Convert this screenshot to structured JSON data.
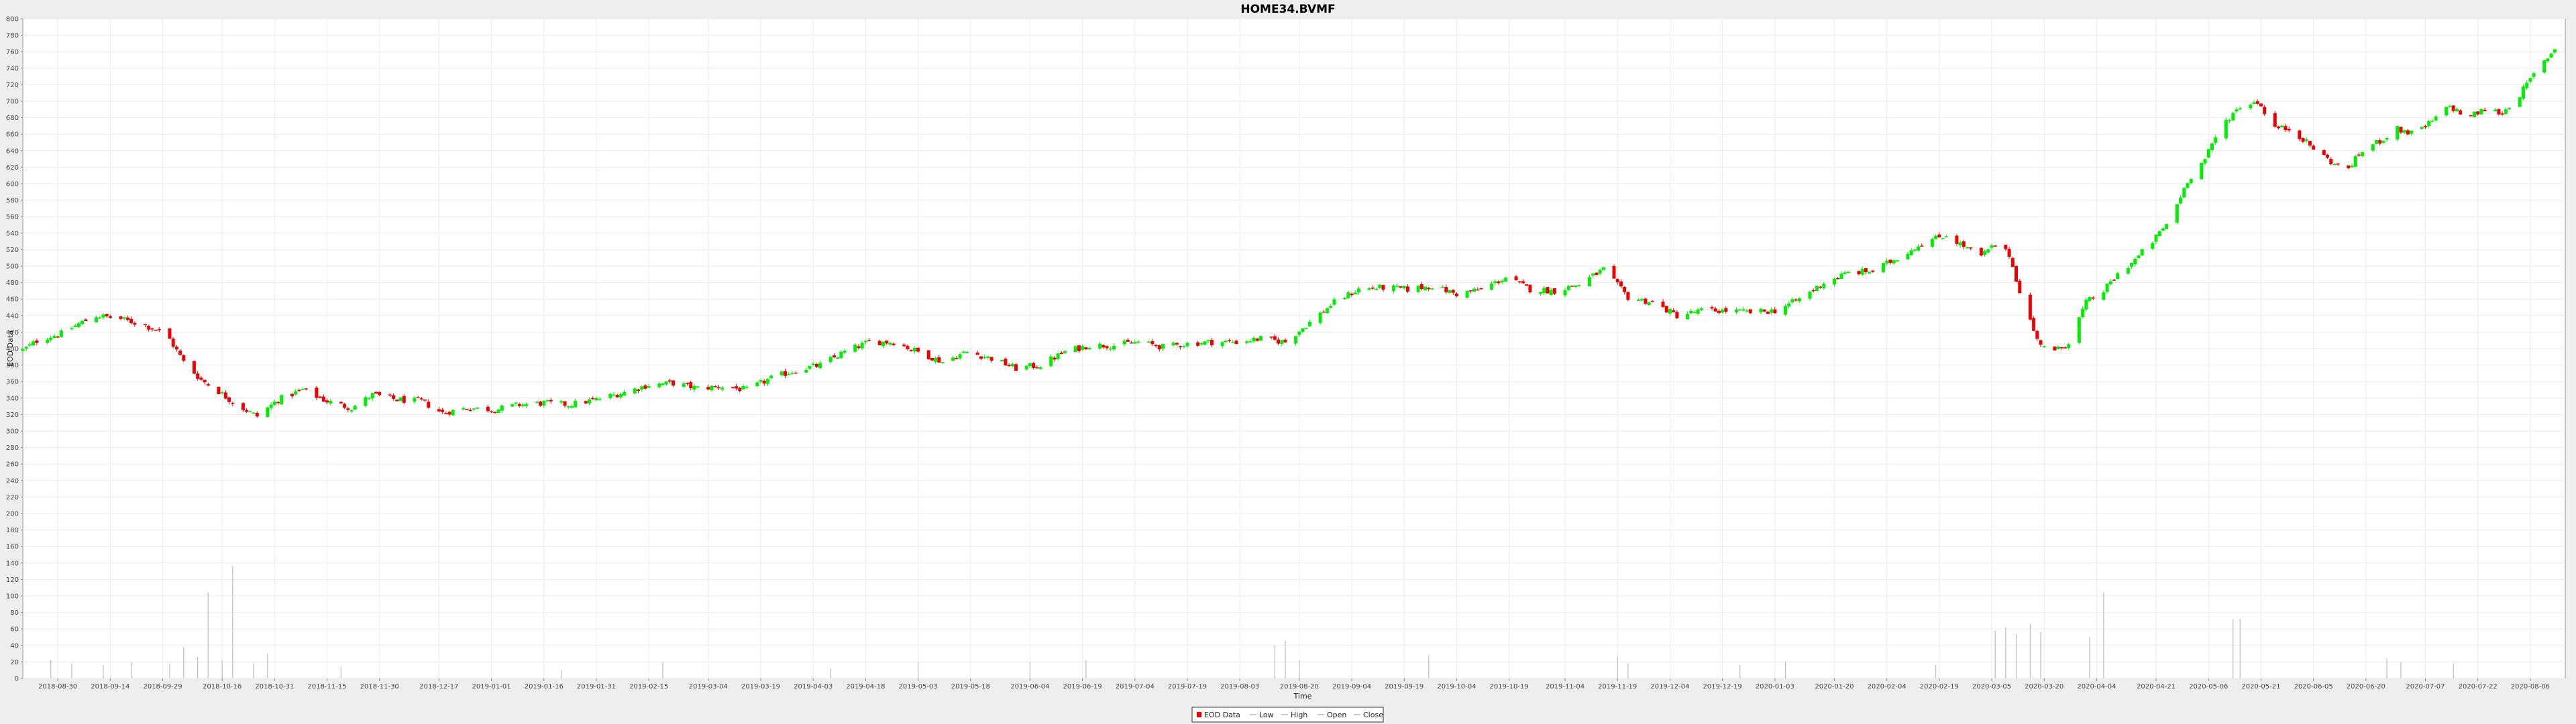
{
  "chart_data": {
    "type": "candlestick",
    "title": "HOME34.BVMF",
    "xlabel": "Time",
    "ylabel": "EOD Data",
    "ylim": [
      0,
      800
    ],
    "y_ticks": [
      0,
      20,
      40,
      60,
      80,
      100,
      120,
      140,
      160,
      180,
      200,
      220,
      240,
      260,
      280,
      300,
      320,
      340,
      360,
      380,
      400,
      420,
      440,
      460,
      480,
      500,
      520,
      540,
      560,
      580,
      600,
      620,
      640,
      660,
      680,
      700,
      720,
      740,
      760,
      780,
      800
    ],
    "x_range": [
      "2018-08-20",
      "2020-08-16"
    ],
    "x_ticks": [
      "2018-08-30",
      "2018-09-14",
      "2018-09-29",
      "2018-10-16",
      "2018-10-31",
      "2018-11-15",
      "2018-11-30",
      "2018-12-17",
      "2019-01-01",
      "2019-01-16",
      "2019-01-31",
      "2019-02-15",
      "2019-03-04",
      "2019-03-19",
      "2019-04-03",
      "2019-04-18",
      "2019-05-03",
      "2019-05-18",
      "2019-06-04",
      "2019-06-19",
      "2019-07-04",
      "2019-07-19",
      "2019-08-03",
      "2019-08-20",
      "2019-09-04",
      "2019-09-19",
      "2019-10-04",
      "2019-10-19",
      "2019-11-04",
      "2019-11-19",
      "2019-12-04",
      "2019-12-19",
      "2020-01-03",
      "2020-01-20",
      "2020-02-04",
      "2020-02-19",
      "2020-03-05",
      "2020-03-20",
      "2020-04-04",
      "2020-04-21",
      "2020-05-06",
      "2020-05-21",
      "2020-06-05",
      "2020-06-20",
      "2020-07-07",
      "2020-07-22",
      "2020-08-06"
    ],
    "grid": true,
    "legend": {
      "position": "bottom-center",
      "entries": [
        "EOD Data",
        "Low",
        "High",
        "Open",
        "Close"
      ]
    },
    "colors": {
      "up": "#00ee00",
      "down": "#ee0000",
      "volume": "#bbbbbb",
      "plot_bg": "#ffffff",
      "grid": "#ebebeb"
    },
    "series": [
      {
        "name": "EOD Data",
        "style": "candles",
        "close_anchors": [
          [
            "2018-08-20",
            398
          ],
          [
            "2018-08-25",
            412
          ],
          [
            "2018-08-31",
            418
          ],
          [
            "2018-09-05",
            430
          ],
          [
            "2018-09-10",
            440
          ],
          [
            "2018-09-17",
            436
          ],
          [
            "2018-09-24",
            428
          ],
          [
            "2018-09-30",
            418
          ],
          [
            "2018-10-05",
            384
          ],
          [
            "2018-10-10",
            362
          ],
          [
            "2018-10-15",
            348
          ],
          [
            "2018-10-20",
            332
          ],
          [
            "2018-10-26",
            318
          ],
          [
            "2018-11-01",
            338
          ],
          [
            "2018-11-08",
            350
          ],
          [
            "2018-11-15",
            336
          ],
          [
            "2018-11-22",
            328
          ],
          [
            "2018-11-28",
            344
          ],
          [
            "2018-12-05",
            338
          ],
          [
            "2018-12-12",
            336
          ],
          [
            "2018-12-18",
            322
          ],
          [
            "2018-12-25",
            328
          ],
          [
            "2019-01-02",
            326
          ],
          [
            "2019-01-09",
            332
          ],
          [
            "2019-01-16",
            334
          ],
          [
            "2019-01-23",
            332
          ],
          [
            "2019-01-31",
            338
          ],
          [
            "2019-02-07",
            346
          ],
          [
            "2019-02-15",
            356
          ],
          [
            "2019-02-22",
            358
          ],
          [
            "2019-03-01",
            352
          ],
          [
            "2019-03-08",
            354
          ],
          [
            "2019-03-15",
            350
          ],
          [
            "2019-03-22",
            364
          ],
          [
            "2019-03-29",
            374
          ],
          [
            "2019-04-05",
            380
          ],
          [
            "2019-04-12",
            396
          ],
          [
            "2019-04-19",
            408
          ],
          [
            "2019-04-26",
            408
          ],
          [
            "2019-05-03",
            396
          ],
          [
            "2019-05-10",
            384
          ],
          [
            "2019-05-17",
            396
          ],
          [
            "2019-05-24",
            388
          ],
          [
            "2019-05-31",
            376
          ],
          [
            "2019-06-07",
            380
          ],
          [
            "2019-06-14",
            396
          ],
          [
            "2019-06-21",
            404
          ],
          [
            "2019-06-28",
            404
          ],
          [
            "2019-07-05",
            408
          ],
          [
            "2019-07-12",
            402
          ],
          [
            "2019-07-19",
            406
          ],
          [
            "2019-07-26",
            408
          ],
          [
            "2019-08-02",
            408
          ],
          [
            "2019-08-09",
            412
          ],
          [
            "2019-08-16",
            408
          ],
          [
            "2019-08-23",
            432
          ],
          [
            "2019-08-30",
            456
          ],
          [
            "2019-09-06",
            472
          ],
          [
            "2019-09-13",
            474
          ],
          [
            "2019-09-20",
            472
          ],
          [
            "2019-09-27",
            476
          ],
          [
            "2019-10-04",
            466
          ],
          [
            "2019-10-11",
            472
          ],
          [
            "2019-10-18",
            486
          ],
          [
            "2019-10-25",
            472
          ],
          [
            "2019-11-01",
            470
          ],
          [
            "2019-11-08",
            478
          ],
          [
            "2019-11-15",
            496
          ],
          [
            "2019-11-22",
            462
          ],
          [
            "2019-11-29",
            456
          ],
          [
            "2019-12-06",
            440
          ],
          [
            "2019-12-13",
            446
          ],
          [
            "2019-12-20",
            446
          ],
          [
            "2019-12-27",
            444
          ],
          [
            "2020-01-03",
            446
          ],
          [
            "2020-01-10",
            460
          ],
          [
            "2020-01-17",
            480
          ],
          [
            "2020-01-24",
            492
          ],
          [
            "2020-01-31",
            494
          ],
          [
            "2020-02-07",
            510
          ],
          [
            "2020-02-14",
            528
          ],
          [
            "2020-02-21",
            538
          ],
          [
            "2020-02-26",
            524
          ],
          [
            "2020-03-02",
            512
          ],
          [
            "2020-03-06",
            526
          ],
          [
            "2020-03-10",
            514
          ],
          [
            "2020-03-13",
            470
          ],
          [
            "2020-03-18",
            410
          ],
          [
            "2020-03-23",
            396
          ],
          [
            "2020-03-27",
            408
          ],
          [
            "2020-04-01",
            456
          ],
          [
            "2020-04-06",
            470
          ],
          [
            "2020-04-10",
            490
          ],
          [
            "2020-04-15",
            508
          ],
          [
            "2020-04-20",
            530
          ],
          [
            "2020-04-25",
            556
          ],
          [
            "2020-04-30",
            604
          ],
          [
            "2020-05-05",
            630
          ],
          [
            "2020-05-10",
            672
          ],
          [
            "2020-05-15",
            694
          ],
          [
            "2020-05-20",
            700
          ],
          [
            "2020-05-25",
            668
          ],
          [
            "2020-05-30",
            666
          ],
          [
            "2020-06-04",
            646
          ],
          [
            "2020-06-09",
            630
          ],
          [
            "2020-06-14",
            614
          ],
          [
            "2020-06-19",
            640
          ],
          [
            "2020-06-24",
            652
          ],
          [
            "2020-06-29",
            666
          ],
          [
            "2020-07-04",
            660
          ],
          [
            "2020-07-09",
            676
          ],
          [
            "2020-07-14",
            694
          ],
          [
            "2020-07-19",
            680
          ],
          [
            "2020-07-24",
            690
          ],
          [
            "2020-07-29",
            686
          ],
          [
            "2020-08-03",
            708
          ],
          [
            "2020-08-08",
            738
          ],
          [
            "2020-08-13",
            764
          ]
        ]
      },
      {
        "name": "Volume",
        "style": "bars",
        "values": [
          [
            "2018-08-28",
            22
          ],
          [
            "2018-09-03",
            18
          ],
          [
            "2018-09-12",
            16
          ],
          [
            "2018-09-20",
            20
          ],
          [
            "2018-10-01",
            18
          ],
          [
            "2018-10-05",
            38
          ],
          [
            "2018-10-09",
            26
          ],
          [
            "2018-10-12",
            104
          ],
          [
            "2018-10-16",
            22
          ],
          [
            "2018-10-19",
            136
          ],
          [
            "2018-10-25",
            18
          ],
          [
            "2018-10-29",
            30
          ],
          [
            "2018-11-19",
            14
          ],
          [
            "2019-01-21",
            10
          ],
          [
            "2019-02-19",
            20
          ],
          [
            "2019-04-08",
            12
          ],
          [
            "2019-05-03",
            20
          ],
          [
            "2019-06-04",
            20
          ],
          [
            "2019-06-20",
            22
          ],
          [
            "2019-08-13",
            40
          ],
          [
            "2019-08-16",
            46
          ],
          [
            "2019-08-20",
            22
          ],
          [
            "2019-09-26",
            28
          ],
          [
            "2019-11-19",
            26
          ],
          [
            "2019-11-22",
            18
          ],
          [
            "2019-12-24",
            16
          ],
          [
            "2020-01-06",
            20
          ],
          [
            "2020-02-18",
            16
          ],
          [
            "2020-03-06",
            58
          ],
          [
            "2020-03-09",
            62
          ],
          [
            "2020-03-12",
            54
          ],
          [
            "2020-03-16",
            66
          ],
          [
            "2020-03-19",
            56
          ],
          [
            "2020-04-02",
            50
          ],
          [
            "2020-04-06",
            104
          ],
          [
            "2020-05-13",
            72
          ],
          [
            "2020-05-15",
            72
          ],
          [
            "2020-06-26",
            24
          ],
          [
            "2020-06-30",
            20
          ],
          [
            "2020-07-15",
            18
          ]
        ]
      }
    ]
  }
}
